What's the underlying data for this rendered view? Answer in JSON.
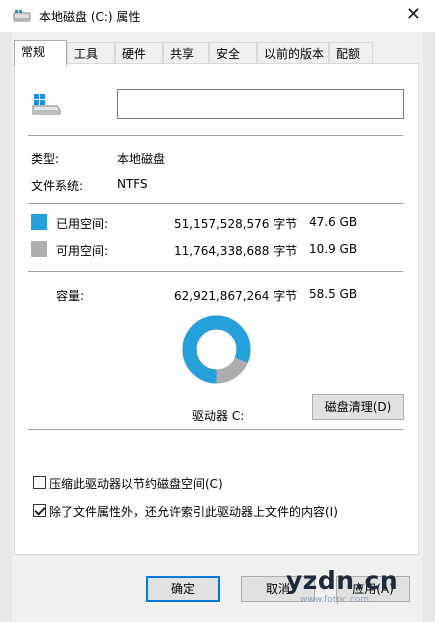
{
  "window": {
    "title": "本地磁盘 (C:) 属性",
    "close_glyph": "✕"
  },
  "tabs": [
    "常规",
    "工具",
    "硬件",
    "共享",
    "安全",
    "以前的版本",
    "配额"
  ],
  "general": {
    "name_value": "",
    "type_label": "类型:",
    "type_value": "本地磁盘",
    "fs_label": "文件系统:",
    "fs_value": "NTFS",
    "used": {
      "label": "已用空间:",
      "bytes": "51,157,528,576 字节",
      "size": "47.6 GB",
      "color": "#26a0da"
    },
    "free": {
      "label": "可用空间:",
      "bytes": "11,764,338,688 字节",
      "size": "10.9 GB",
      "color": "#adadad"
    },
    "capacity": {
      "label": "容量:",
      "bytes": "62,921,867,264 字节",
      "size": "58.5 GB"
    },
    "used_fraction": 0.813,
    "drive_label": "驱动器 C:",
    "cleanup_button": "磁盘清理(D)",
    "compress_label": "压缩此驱动器以节约磁盘空间(C)",
    "compress_checked": false,
    "index_label": "除了文件属性外，还允许索引此驱动器上文件的内容(I)",
    "index_checked": true
  },
  "buttons": {
    "ok": "确定",
    "cancel": "取消",
    "apply": "应用(A)"
  },
  "watermark": {
    "text": "yzdn.cn",
    "sub": "www.fotpc.com"
  }
}
